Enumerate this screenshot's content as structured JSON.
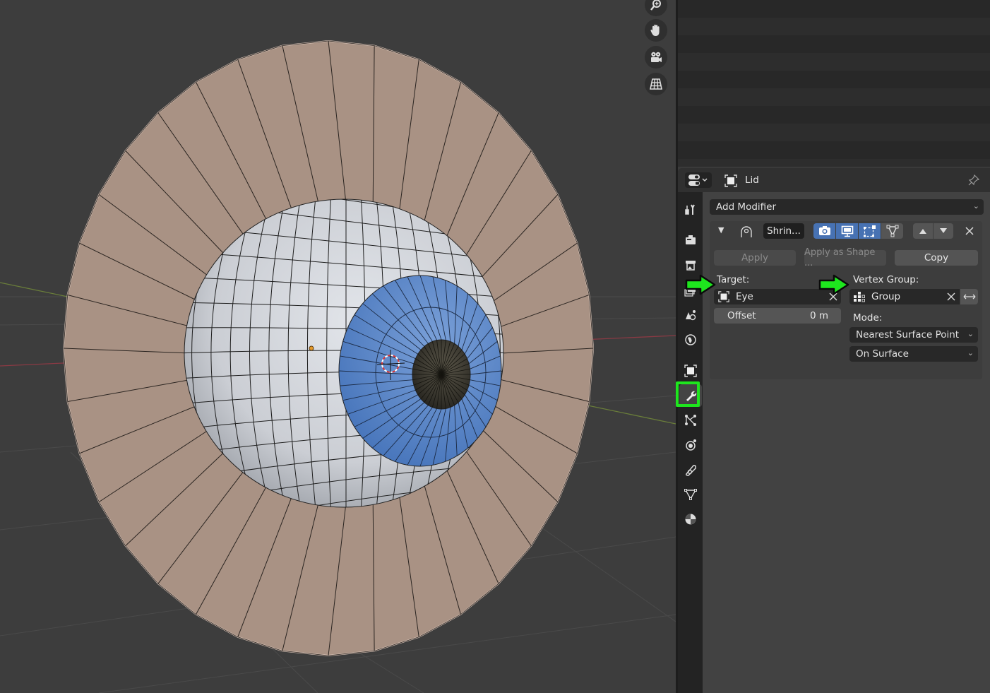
{
  "viewport": {
    "nav_buttons": [
      {
        "name": "zoom-icon"
      },
      {
        "name": "pan-hand-icon"
      },
      {
        "name": "camera-view-icon"
      },
      {
        "name": "ortho-grid-icon"
      }
    ],
    "scene_objects": [
      "Lid",
      "Eye"
    ],
    "colors": {
      "lid": "#a99284",
      "eyeball": "#d4d7dc",
      "iris": "#4f7fc4",
      "pupil": "#3c3a33",
      "background": "#3d3d3d"
    }
  },
  "properties": {
    "editor_type_icon": "properties-editor-icon",
    "object_name": "Lid",
    "pin_icon": "pin-icon",
    "tabs": [
      {
        "name": "tool",
        "icon": "tool-icon"
      },
      {
        "name": "render",
        "icon": "render-icon"
      },
      {
        "name": "output",
        "icon": "output-icon"
      },
      {
        "name": "view-layer",
        "icon": "view-layer-icon"
      },
      {
        "name": "scene",
        "icon": "scene-icon"
      },
      {
        "name": "world",
        "icon": "world-icon"
      },
      {
        "name": "object",
        "icon": "object-icon"
      },
      {
        "name": "modifiers",
        "icon": "wrench-icon",
        "active": true,
        "highlighted": true
      },
      {
        "name": "particles",
        "icon": "particles-icon"
      },
      {
        "name": "physics",
        "icon": "physics-icon"
      },
      {
        "name": "constraints",
        "icon": "constraints-icon"
      },
      {
        "name": "data",
        "icon": "mesh-data-icon"
      },
      {
        "name": "material",
        "icon": "material-icon"
      }
    ],
    "add_modifier_label": "Add Modifier",
    "modifier": {
      "name": "Shrin...",
      "type_icon": "shrinkwrap-icon",
      "toggles": [
        {
          "name": "render",
          "icon": "camera-icon",
          "on": true
        },
        {
          "name": "viewport",
          "icon": "monitor-icon",
          "on": true
        },
        {
          "name": "edit-mode",
          "icon": "edit-mode-icon",
          "on": true
        },
        {
          "name": "on-cage",
          "icon": "cage-icon",
          "on": false
        }
      ],
      "apply_label": "Apply",
      "apply_shape_label": "Apply as Shape ...",
      "copy_label": "Copy",
      "target_label": "Target:",
      "target_value": "Eye",
      "offset_label": "Offset",
      "offset_value": "0 m",
      "vertex_group_label": "Vertex Group:",
      "vertex_group_value": "Group",
      "mode_label": "Mode:",
      "wrap_method": "Nearest Surface Point",
      "snap_mode": "On Surface"
    },
    "annotation_color": "#1ee61e"
  }
}
